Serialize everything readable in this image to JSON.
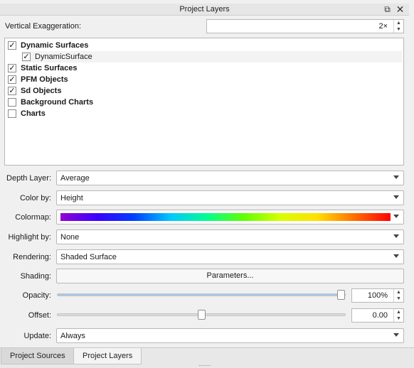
{
  "window": {
    "title": "Project Layers"
  },
  "vertical_exaggeration": {
    "label": "Vertical Exaggeration:",
    "value": "2×"
  },
  "layers": [
    {
      "label": "Dynamic Surfaces",
      "checked": true,
      "level": 0
    },
    {
      "label": "DynamicSurface",
      "checked": true,
      "level": 1
    },
    {
      "label": "Static Surfaces",
      "checked": true,
      "level": 0
    },
    {
      "label": "PFM Objects",
      "checked": true,
      "level": 0
    },
    {
      "label": "Sd Objects",
      "checked": true,
      "level": 0
    },
    {
      "label": "Background Charts",
      "checked": false,
      "level": 0
    },
    {
      "label": "Charts",
      "checked": false,
      "level": 0
    }
  ],
  "properties": {
    "depth_layer": {
      "label": "Depth Layer:",
      "value": "Average"
    },
    "color_by": {
      "label": "Color by:",
      "value": "Height"
    },
    "colormap": {
      "label": "Colormap:"
    },
    "highlight_by": {
      "label": "Highlight by:",
      "value": "None"
    },
    "rendering": {
      "label": "Rendering:",
      "value": "Shaded Surface"
    },
    "shading": {
      "label": "Shading:",
      "button": "Parameters..."
    },
    "opacity": {
      "label": "Opacity:",
      "value": "100%",
      "level": 1.0
    },
    "offset": {
      "label": "Offset:",
      "value": "0.00",
      "level": 0.5
    },
    "update": {
      "label": "Update:",
      "value": "Always"
    }
  },
  "tabs": [
    {
      "label": "Project Sources",
      "active": false
    },
    {
      "label": "Project Layers",
      "active": true
    }
  ],
  "icons": {
    "float": "float-window-icon",
    "close": "close-icon"
  }
}
